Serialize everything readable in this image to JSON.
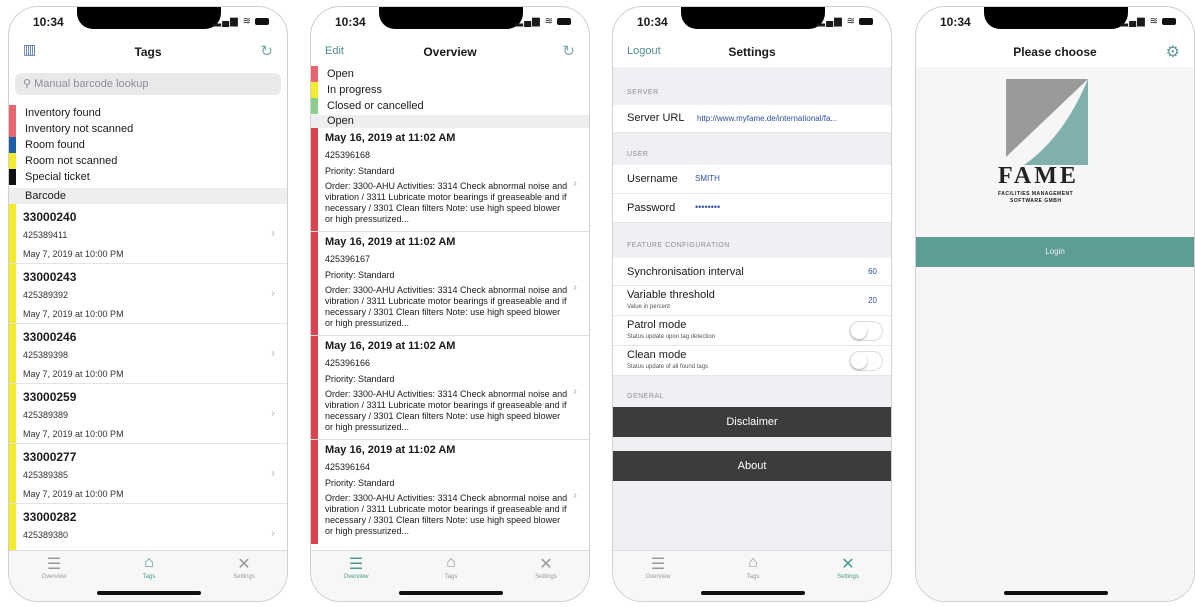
{
  "status": {
    "time": "10:34"
  },
  "tags_screen": {
    "title": "Tags",
    "search_placeholder": "Manual barcode lookup",
    "legend": [
      {
        "label": "Inventory found",
        "color": "#e8646e"
      },
      {
        "label": "Inventory not scanned",
        "color": "#e8646e"
      },
      {
        "label": "Room found",
        "color": "#1f5fa8"
      },
      {
        "label": "Room not scanned",
        "color": "#f3ec2c"
      },
      {
        "label": "Special ticket",
        "color": "#111111"
      }
    ],
    "section": "Barcode",
    "rows": [
      {
        "code": "33000240",
        "number": "425389411",
        "date": "May 7, 2019 at 10:00 PM"
      },
      {
        "code": "33000243",
        "number": "425389392",
        "date": "May 7, 2019 at 10:00 PM"
      },
      {
        "code": "33000246",
        "number": "425389398",
        "date": "May 7, 2019 at 10:00 PM"
      },
      {
        "code": "33000259",
        "number": "425389389",
        "date": "May 7, 2019 at 10:00 PM"
      },
      {
        "code": "33000277",
        "number": "425389385",
        "date": "May 7, 2019 at 10:00 PM"
      },
      {
        "code": "33000282",
        "number": "425389380",
        "date": ""
      }
    ]
  },
  "overview_screen": {
    "title": "Overview",
    "edit_label": "Edit",
    "legend": [
      {
        "label": "Open",
        "color": "#e8646e"
      },
      {
        "label": "In progress",
        "color": "#f3ec2c"
      },
      {
        "label": "Closed or cancelled",
        "color": "#8ccf8a"
      }
    ],
    "section": "Open",
    "rows": [
      {
        "date": "May 16, 2019 at 11:02 AM",
        "id": "425396168",
        "priority": "Priority: Standard",
        "text": "Order: 3300-AHU Activities: 3314 Check abnormal noise and vibration / 3311 Lubricate motor bearings if greaseable and if necessary / 3301 Clean filters Note: use high speed blower or high pressurized..."
      },
      {
        "date": "May 16, 2019 at 11:02 AM",
        "id": "425396167",
        "priority": "Priority: Standard",
        "text": "Order: 3300-AHU Activities: 3314 Check abnormal noise and vibration / 3311 Lubricate motor bearings if greaseable and if necessary / 3301 Clean filters Note: use high speed blower or high pressurized..."
      },
      {
        "date": "May 16, 2019 at 11:02 AM",
        "id": "425396166",
        "priority": "Priority: Standard",
        "text": "Order: 3300-AHU Activities: 3314 Check abnormal noise and vibration / 3311 Lubricate motor bearings if greaseable and if necessary / 3301 Clean filters Note: use high speed blower or high pressurized..."
      },
      {
        "date": "May 16, 2019 at 11:02 AM",
        "id": "425396164",
        "priority": "Priority: Standard",
        "text": "Order: 3300-AHU Activities: 3314 Check abnormal noise and vibration / 3311 Lubricate motor bearings if greaseable and if necessary / 3301 Clean filters Note: use high speed blower or high pressurized..."
      }
    ]
  },
  "settings_screen": {
    "title": "Settings",
    "logout_label": "Logout",
    "server_header": "SERVER",
    "server_url_label": "Server URL",
    "server_url_value": "http://www.myfame.de/international/fa...",
    "user_header": "USER",
    "username_label": "Username",
    "username_value": "SMITH",
    "password_label": "Password",
    "password_value": "••••••••",
    "feature_header": "FEATURE CONFIGURATION",
    "sync_label": "Synchronisation interval",
    "sync_value": "60",
    "threshold_label": "Variable threshold",
    "threshold_sub": "Value in percent",
    "threshold_value": "20",
    "patrol_label": "Patrol mode",
    "patrol_sub": "Status update upon tag detection",
    "patrol_on": false,
    "clean_label": "Clean mode",
    "clean_sub": "Status update of all found tags",
    "clean_on": false,
    "general_header": "GENERAL",
    "disclaimer_label": "Disclaimer",
    "about_label": "About"
  },
  "login_screen": {
    "title": "Please choose",
    "logo_text": "FAME",
    "logo_sub1": "Facilities Management",
    "logo_sub2": "Software GmbH",
    "login_label": "Login"
  },
  "tabbar": {
    "overview": "Overview",
    "tags": "Tags",
    "settings": "Settings"
  },
  "colors": {
    "accent": "#4a9a8e",
    "login_bg": "#5e9c96",
    "dark_button": "#3c3c3c"
  }
}
